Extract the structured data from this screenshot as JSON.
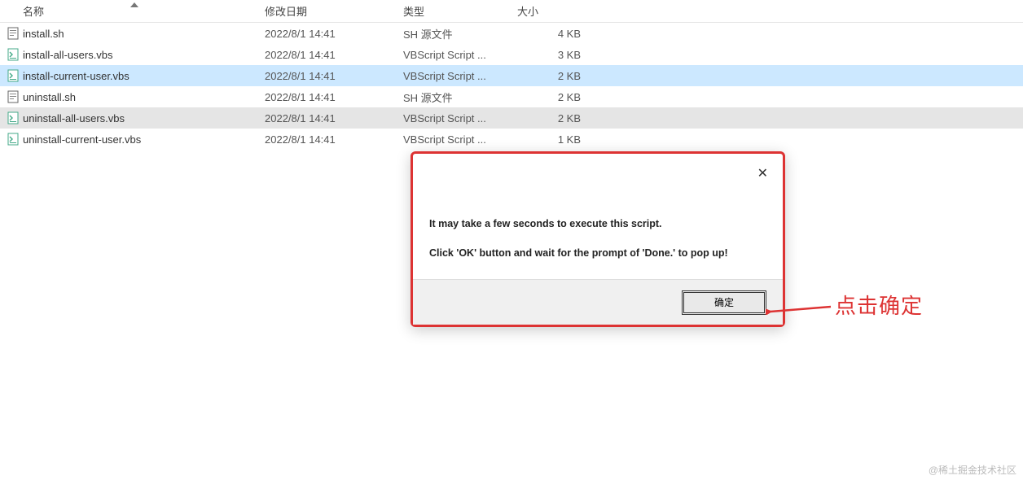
{
  "columns": {
    "name": "名称",
    "date": "修改日期",
    "type": "类型",
    "size": "大小"
  },
  "files": [
    {
      "name": "install.sh",
      "date": "2022/8/1 14:41",
      "type": "SH 源文件",
      "size": "4 KB",
      "iconKind": "sh",
      "state": ""
    },
    {
      "name": "install-all-users.vbs",
      "date": "2022/8/1 14:41",
      "type": "VBScript Script ...",
      "size": "3 KB",
      "iconKind": "vbs",
      "state": ""
    },
    {
      "name": "install-current-user.vbs",
      "date": "2022/8/1 14:41",
      "type": "VBScript Script ...",
      "size": "2 KB",
      "iconKind": "vbs",
      "state": "selected"
    },
    {
      "name": "uninstall.sh",
      "date": "2022/8/1 14:41",
      "type": "SH 源文件",
      "size": "2 KB",
      "iconKind": "sh",
      "state": ""
    },
    {
      "name": "uninstall-all-users.vbs",
      "date": "2022/8/1 14:41",
      "type": "VBScript Script ...",
      "size": "2 KB",
      "iconKind": "vbs",
      "state": "highlight"
    },
    {
      "name": "uninstall-current-user.vbs",
      "date": "2022/8/1 14:41",
      "type": "VBScript Script ...",
      "size": "1 KB",
      "iconKind": "vbs",
      "state": ""
    }
  ],
  "dialog": {
    "line1": "It may take a few seconds to execute this script.",
    "line2": "Click 'OK' button and wait for the prompt of 'Done.' to pop up!",
    "ok": "确定"
  },
  "annotation": "点击确定",
  "watermark": "@稀土掘金技术社区"
}
